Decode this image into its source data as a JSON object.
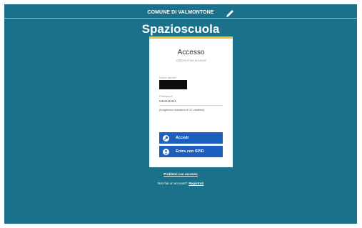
{
  "header": {
    "comune": "COMUNE DI VALMONTONE",
    "edit_icon": "pencil-icon",
    "app_title": "Spazioscuola"
  },
  "colors": {
    "background": "#1b7189",
    "card": "#ffffff",
    "card_accent": "#f2c01a",
    "button": "#1c5fbf"
  },
  "login": {
    "title": "Accesso",
    "subtitle": "Utilizza il tuo account",
    "username_label": "Nome utente*",
    "password_label": "Password*",
    "password_value": "••••••••••••",
    "password_hint": "(lunghezza massima di 12 caratteri)",
    "login_button": "Accedi",
    "login_icon": "key-icon",
    "spid_button": "Entra con SPID",
    "spid_icon": "user-icon"
  },
  "footer": {
    "problems_link": "Problemi con accesso",
    "no_account_text": "Non hai un account?",
    "register_link": "Registrati"
  }
}
